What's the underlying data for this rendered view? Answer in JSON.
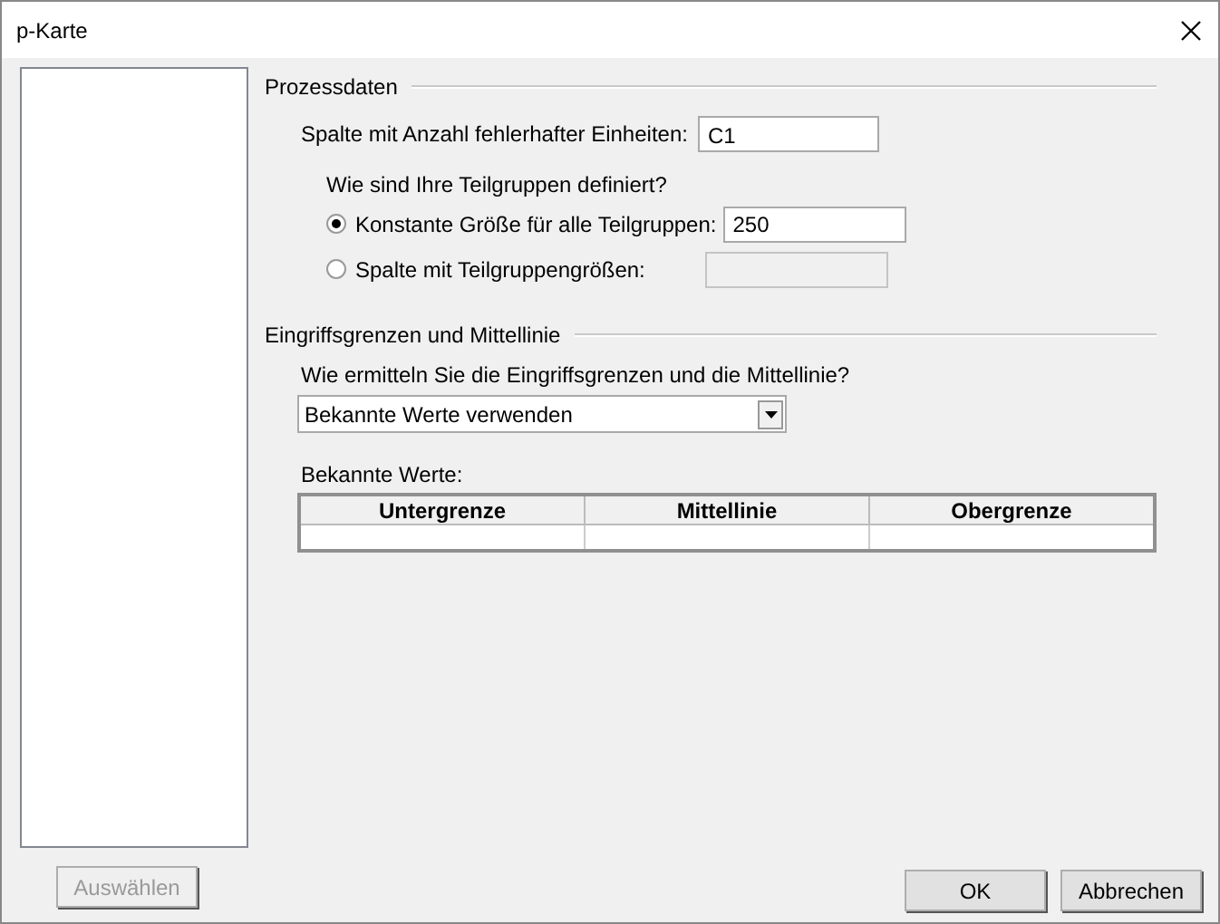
{
  "window": {
    "title": "p-Karte"
  },
  "process_data": {
    "title": "Prozessdaten",
    "column_label": "Spalte mit Anzahl fehlerhafter Einheiten:",
    "column_value": "C1",
    "subgroup_question": "Wie sind Ihre Teilgruppen definiert?",
    "subgroup_options": [
      {
        "label": "Konstante Größe für alle Teilgruppen:",
        "selected": true,
        "value": "250"
      },
      {
        "label": "Spalte mit Teilgruppengrößen:",
        "selected": false
      }
    ]
  },
  "control_limits": {
    "title": "Eingriffsgrenzen und Mittellinie",
    "question": "Wie ermitteln Sie die Eingriffsgrenzen und die Mittellinie?",
    "method": "Bekannte Werte verwenden",
    "known_values_label": "Bekannte Werte:",
    "table": {
      "columns": [
        "Untergrenze",
        "Mittellinie",
        "Obergrenze"
      ]
    }
  },
  "buttons": [
    {
      "label": "Auswählen",
      "disabled": true
    },
    {
      "label": "OK",
      "disabled": false
    },
    {
      "label": "Abbrechen",
      "disabled": false
    }
  ]
}
